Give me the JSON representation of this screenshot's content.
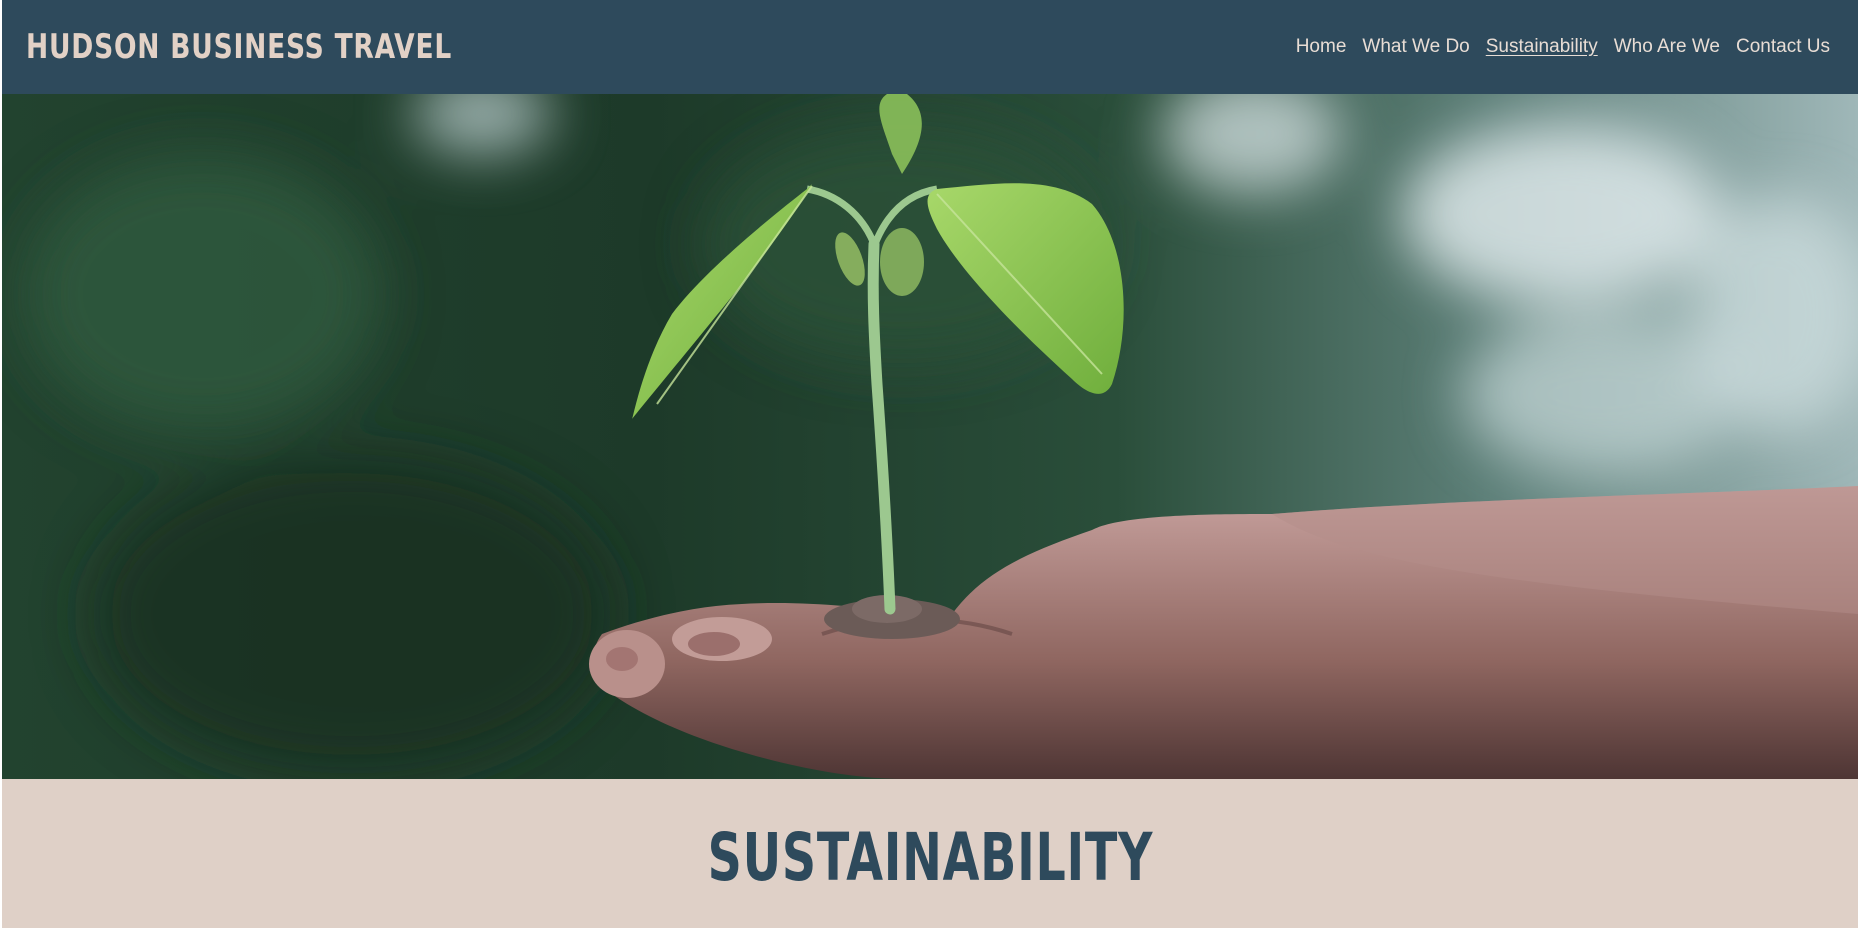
{
  "header": {
    "brand": "HUDSON BUSINESS TRAVEL",
    "nav": [
      {
        "label": "Home",
        "active": false
      },
      {
        "label": "What We Do",
        "active": false
      },
      {
        "label": "Sustainability",
        "active": true
      },
      {
        "label": "Who Are We",
        "active": false
      },
      {
        "label": "Contact Us",
        "active": false
      }
    ]
  },
  "hero": {
    "image": "seedling-in-hand-photo"
  },
  "section": {
    "title": "SUSTAINABILITY"
  },
  "colors": {
    "navbar": "#2e4a5c",
    "brand_text": "#e2d1c6",
    "band": "#dfd0c7",
    "title": "#2e4a5c"
  }
}
